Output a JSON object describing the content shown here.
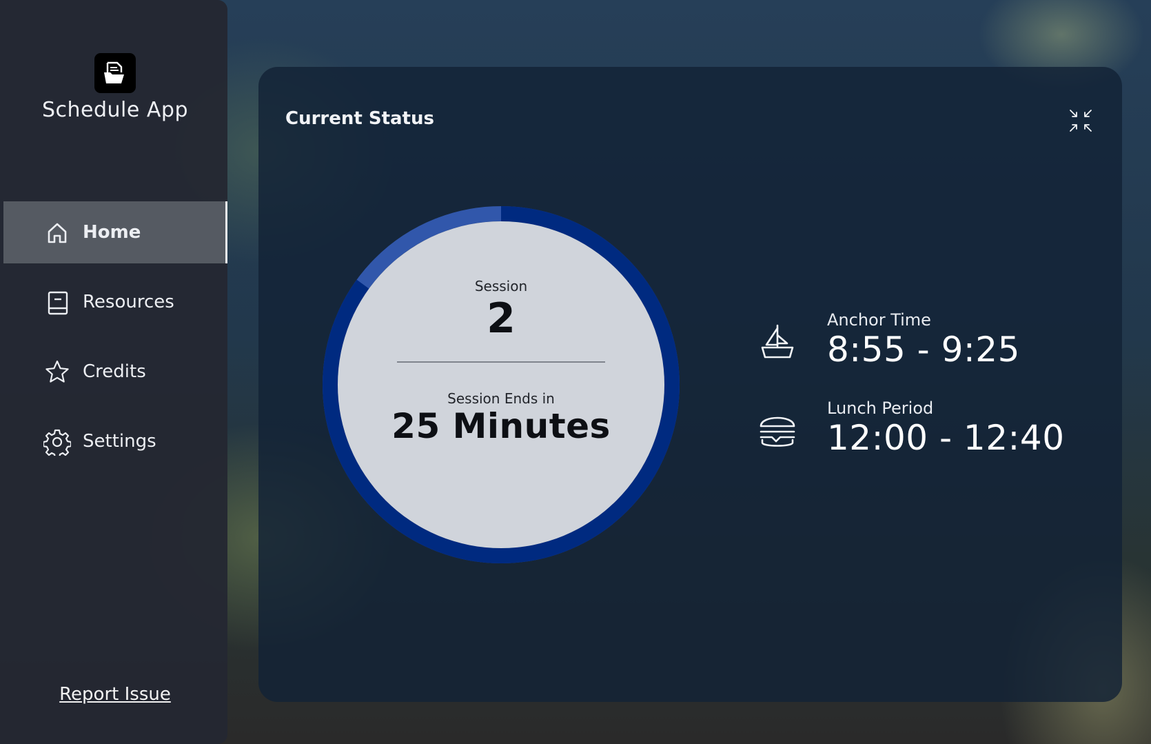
{
  "app": {
    "title": "Schedule App",
    "logo_icon": "folder-document-icon"
  },
  "sidebar": {
    "items": [
      {
        "label": "Home",
        "icon": "home-icon",
        "active": true
      },
      {
        "label": "Resources",
        "icon": "book-icon",
        "active": false
      },
      {
        "label": "Credits",
        "icon": "star-icon",
        "active": false
      },
      {
        "label": "Settings",
        "icon": "gear-icon",
        "active": false
      }
    ],
    "report_link": "Report Issue"
  },
  "status_card": {
    "title": "Current Status",
    "collapse_icon": "collapse-icon",
    "session_label": "Session",
    "session_number": "2",
    "ends_label": "Session Ends in",
    "ends_value": "25 Minutes",
    "progress_fraction": 0.85,
    "info": [
      {
        "label": "Anchor Time",
        "value": "8:55 - 9:25",
        "icon": "sailboat-icon"
      },
      {
        "label": "Lunch Period",
        "value": "12:00 - 12:40",
        "icon": "burger-icon"
      }
    ]
  },
  "colors": {
    "ring_elapsed": "#002a80",
    "ring_remaining": "#3157ab",
    "ring_inner": "#d0d4db",
    "sidebar_active": "#555a62"
  }
}
